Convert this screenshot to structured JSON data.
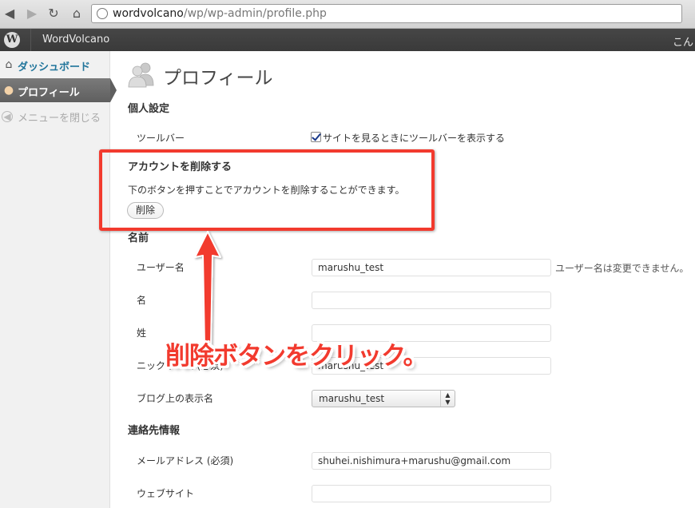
{
  "browser": {
    "url_host": "wordvolcano",
    "url_path": "/wp/wp-admin/profile.php"
  },
  "admin_bar": {
    "site_name": "WordVolcano",
    "right_text": "こん"
  },
  "sidebar": {
    "items": [
      {
        "label": "ダッシュボード",
        "icon": "home-icon"
      },
      {
        "label": "プロフィール",
        "icon": "users-icon"
      },
      {
        "label": "メニューを閉じる",
        "icon": "collapse-icon"
      }
    ]
  },
  "page": {
    "title": "プロフィール"
  },
  "personal": {
    "title": "個人設定",
    "toolbar_label": "ツールバー",
    "toolbar_checkbox_label": "サイトを見るときにツールバーを表示する",
    "toolbar_checked": true
  },
  "delete_account": {
    "title": "アカウントを削除する",
    "description": "下のボタンを押すことでアカウントを削除することができます。",
    "button_label": "削除"
  },
  "name": {
    "title": "名前",
    "username_label": "ユーザー名",
    "username_value": "marushu_test",
    "username_note": "ユーザー名は変更できません。",
    "first_name_label": "名",
    "first_name_value": "",
    "last_name_label": "姓",
    "last_name_value": "",
    "nickname_label": "ニックネーム (必須)",
    "nickname_value": "marushu_test",
    "display_name_label": "ブログ上の表示名",
    "display_name_value": "marushu_test"
  },
  "contact": {
    "title": "連絡先情報",
    "email_label": "メールアドレス (必須)",
    "email_value": "shuhei.nishimura+marushu@gmail.com",
    "website_label": "ウェブサイト",
    "website_value": ""
  },
  "annotation": {
    "text": "削除ボタンをクリック。",
    "color": "#f23a2e"
  }
}
